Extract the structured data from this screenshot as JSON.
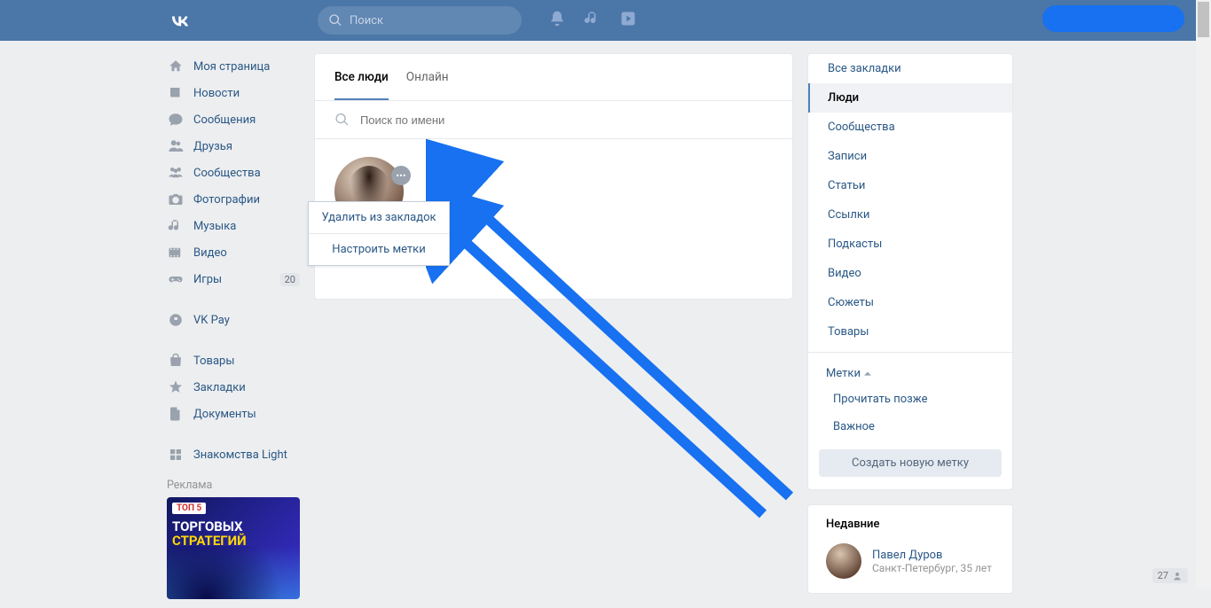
{
  "header": {
    "search_placeholder": "Поиск"
  },
  "nav": {
    "items": [
      {
        "icon": "home",
        "label": "Моя страница"
      },
      {
        "icon": "news",
        "label": "Новости"
      },
      {
        "icon": "msg",
        "label": "Сообщения"
      },
      {
        "icon": "friends",
        "label": "Друзья"
      },
      {
        "icon": "groups",
        "label": "Сообщества"
      },
      {
        "icon": "photo",
        "label": "Фотографии"
      },
      {
        "icon": "music",
        "label": "Музыка"
      },
      {
        "icon": "video",
        "label": "Видео"
      },
      {
        "icon": "games",
        "label": "Игры",
        "badge": "20"
      }
    ],
    "pay_label": "VK Pay",
    "extra": [
      {
        "icon": "bag",
        "label": "Товары"
      },
      {
        "icon": "star",
        "label": "Закладки"
      },
      {
        "icon": "doc",
        "label": "Документы"
      }
    ],
    "dating_label": "Знакомства Light",
    "ad_label": "Реклама",
    "ad": {
      "top": "ТОП 5",
      "l1": "ТОРГОВЫХ",
      "l2": "СТРАТЕГИЙ"
    }
  },
  "main": {
    "tab_all": "Все люди",
    "tab_online": "Онлайн",
    "search_placeholder": "Поиск по имени",
    "person_name": "Павел Дуров",
    "menu_remove": "Удалить из закладок",
    "menu_tags": "Настроить метки"
  },
  "right": {
    "cats": [
      "Все закладки",
      "Люди",
      "Сообщества",
      "Записи",
      "Статьи",
      "Ссылки",
      "Подкасты",
      "Видео",
      "Сюжеты",
      "Товары"
    ],
    "tags_label": "Метки",
    "tags": [
      "Прочитать позже",
      "Важное"
    ],
    "create_label": "Создать новую метку",
    "recent_header": "Недавние",
    "recent_name": "Павел Дуров",
    "recent_sub": "Санкт-Петербург, 35 лет"
  },
  "counter": "27"
}
